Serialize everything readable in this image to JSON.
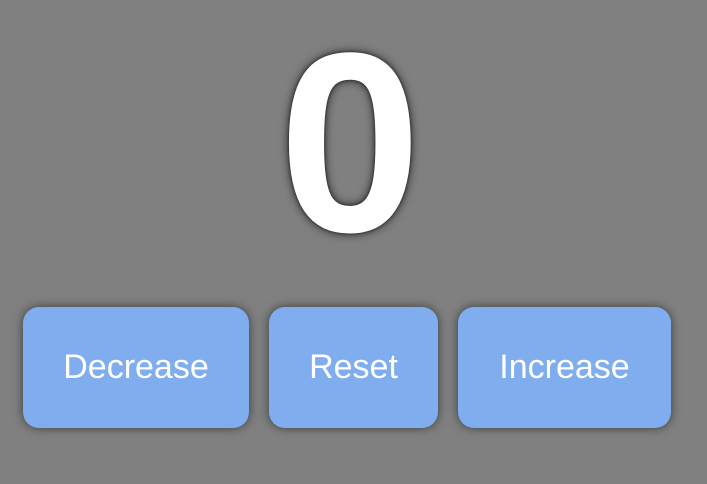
{
  "counter": {
    "value": "0"
  },
  "controls": {
    "decrease_label": "Decrease",
    "reset_label": "Reset",
    "increase_label": "Increase"
  },
  "colors": {
    "background": "#808080",
    "button": "#7fadee",
    "text": "#ffffff"
  }
}
